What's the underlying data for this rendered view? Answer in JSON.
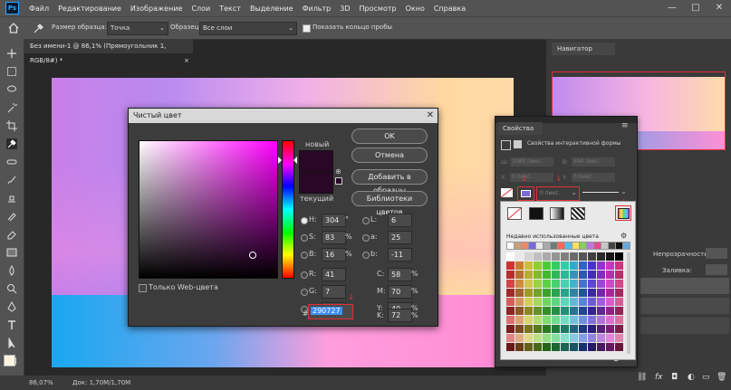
{
  "menu": {
    "app_icon": "Ps",
    "items": [
      "Файл",
      "Редактирование",
      "Изображение",
      "Слои",
      "Текст",
      "Выделение",
      "Фильтр",
      "3D",
      "Просмотр",
      "Окно",
      "Справка"
    ],
    "window_controls": [
      "—",
      "□",
      "✕"
    ]
  },
  "options": {
    "sample_size_label": "Размер образца:",
    "sample_size_value": "Точка",
    "sample_label": "Образец:",
    "sample_value": "Все слои",
    "show_ring_label": "Показать кольцо пробы"
  },
  "document": {
    "tab_title": "Без имени-1 @ 86,1% (Прямоугольник 1, RGB/8#) *",
    "tab_close": "×",
    "zoom": "86,07%",
    "doc_info": "Док: 1,70M/1,70M"
  },
  "navigator": {
    "title": "Навигатор"
  },
  "picker": {
    "title": "Чистый цвет",
    "new_label": "новый",
    "current_label": "текущий",
    "ok": "OK",
    "cancel": "Отмена",
    "add_swatch": "Добавить в образцы",
    "color_libraries": "Библиотеки цветов",
    "web_only": "Только Web-цвета",
    "hex_symbol": "#",
    "hex_value": "290727",
    "fields_left": [
      {
        "label": "H:",
        "value": "304",
        "unit": "°"
      },
      {
        "label": "S:",
        "value": "83",
        "unit": "%"
      },
      {
        "label": "B:",
        "value": "16",
        "unit": "%"
      },
      {
        "label": "R:",
        "value": "41",
        "unit": ""
      },
      {
        "label": "G:",
        "value": "7",
        "unit": ""
      },
      {
        "label": "B:",
        "value": "39",
        "unit": ""
      }
    ],
    "fields_right": [
      {
        "label": "L:",
        "value": "6",
        "unit": ""
      },
      {
        "label": "a:",
        "value": "25",
        "unit": ""
      },
      {
        "label": "b:",
        "value": "-11",
        "unit": ""
      },
      {
        "label": "C:",
        "value": "58",
        "unit": "%"
      },
      {
        "label": "M:",
        "value": "70",
        "unit": "%"
      },
      {
        "label": "Y:",
        "value": "40",
        "unit": "%"
      },
      {
        "label": "K:",
        "value": "72",
        "unit": "%"
      }
    ],
    "new_color": "#290727",
    "current_color": "#290727"
  },
  "properties": {
    "title": "Свойства",
    "subtitle": "Свойства интерактивной формы",
    "w_label": "Ш:",
    "w_value": "1080 пикс.",
    "h_label": "В:",
    "h_value": "594 пикс.",
    "x_label": "X:",
    "x_value": "0 пикс.",
    "y_label": "Y:",
    "y_value": "0 пикс.",
    "stroke_size": "0 пикс.",
    "recent_label": "Недавно использованные цвета",
    "recent_colors": [
      "#ffffff",
      "#c9a07a",
      "#ee8866",
      "#7a6ad8",
      "#e9e9e9",
      "#aaaaaa",
      "#777777",
      "#ff6655",
      "#55bbee",
      "#ffe066",
      "#88cc66",
      "#bb77dd",
      "#e24a94",
      "#c8c8c8",
      "#444444",
      "#111111",
      "#66aadd"
    ]
  },
  "layers_panel": {
    "opacity_label": "Непрозрачность:",
    "fill_label": "Заливка:"
  }
}
